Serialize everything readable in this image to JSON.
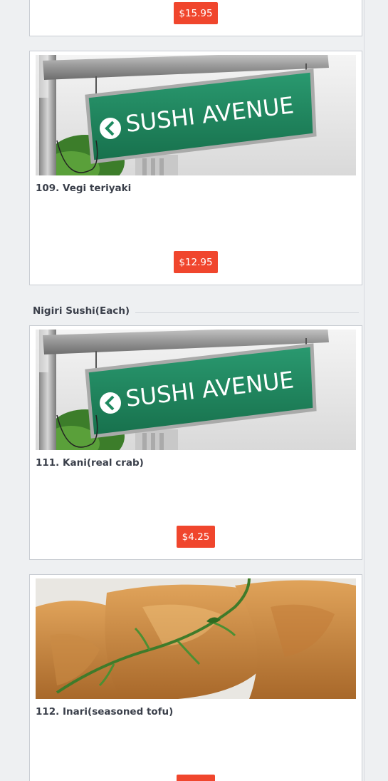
{
  "menu": {
    "previous_card": {
      "price": "$15.95"
    },
    "cards_before_section": [
      {
        "title": "109. Vegi teriyaki",
        "price": "$12.95",
        "image_sign_text": "SUSHI AVENUE"
      }
    ],
    "section": {
      "title": "Nigiri Sushi(Each)",
      "items": [
        {
          "title": "111. Kani(real crab)",
          "price": "$4.25",
          "image_sign_text": "SUSHI AVENUE"
        },
        {
          "title": "112. Inari(seasoned tofu)",
          "price": ""
        }
      ]
    }
  },
  "colors": {
    "price_button": "#f0462d",
    "page_background": "#eef0f2",
    "sign_green": "#1e8a60"
  }
}
